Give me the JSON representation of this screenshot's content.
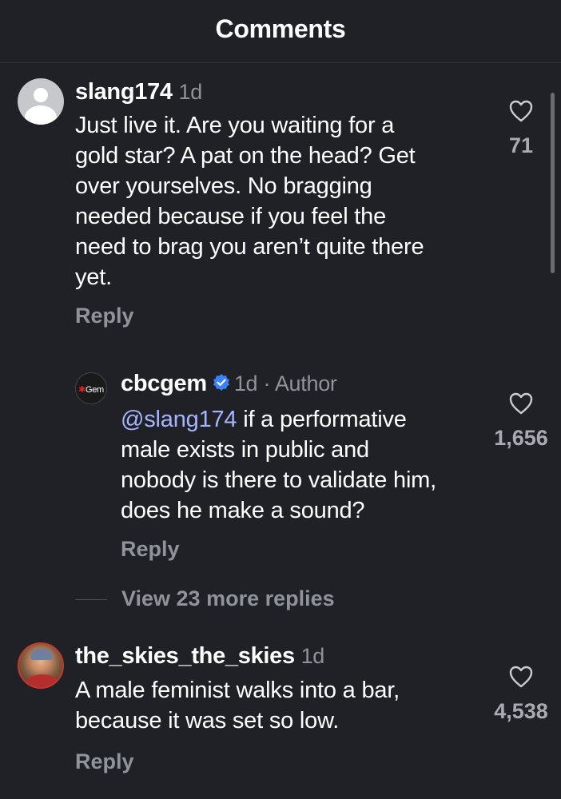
{
  "header": {
    "title": "Comments"
  },
  "comments": [
    {
      "username": "slang174",
      "time": "1d",
      "text_lines": [
        "Just live it. Are you waiting for a",
        "gold star? A pat on the head? Get",
        "over yourselves. No bragging",
        "needed because if you feel the",
        "need to brag you aren’t quite there",
        "yet."
      ],
      "reply_label": "Reply",
      "likes": "71"
    },
    {
      "username": "cbcgem",
      "meta": "1d · Author",
      "avatar_text": "Gem",
      "mention": "@slang174",
      "text_lines": [
        " if a performative",
        "male exists in public and",
        "nobody is there to validate him,",
        "does he make a sound?"
      ],
      "reply_label": "Reply",
      "likes": "1,656"
    },
    {
      "username": "the_skies_the_skies",
      "time": "1d",
      "text_lines": [
        "A male feminist walks into a bar,",
        "because it was set so low."
      ],
      "reply_label": "Reply",
      "likes": "4,538"
    }
  ],
  "view_more": "View 23 more replies",
  "colors": {
    "background": "#1f2127",
    "muted_text": "#8f939b",
    "mention": "#a5b5ff",
    "verified": "#3b82f6"
  },
  "icons": {
    "like": "heart-outline-icon",
    "verified": "verified-badge-icon",
    "avatar_default": "default-avatar-icon"
  }
}
